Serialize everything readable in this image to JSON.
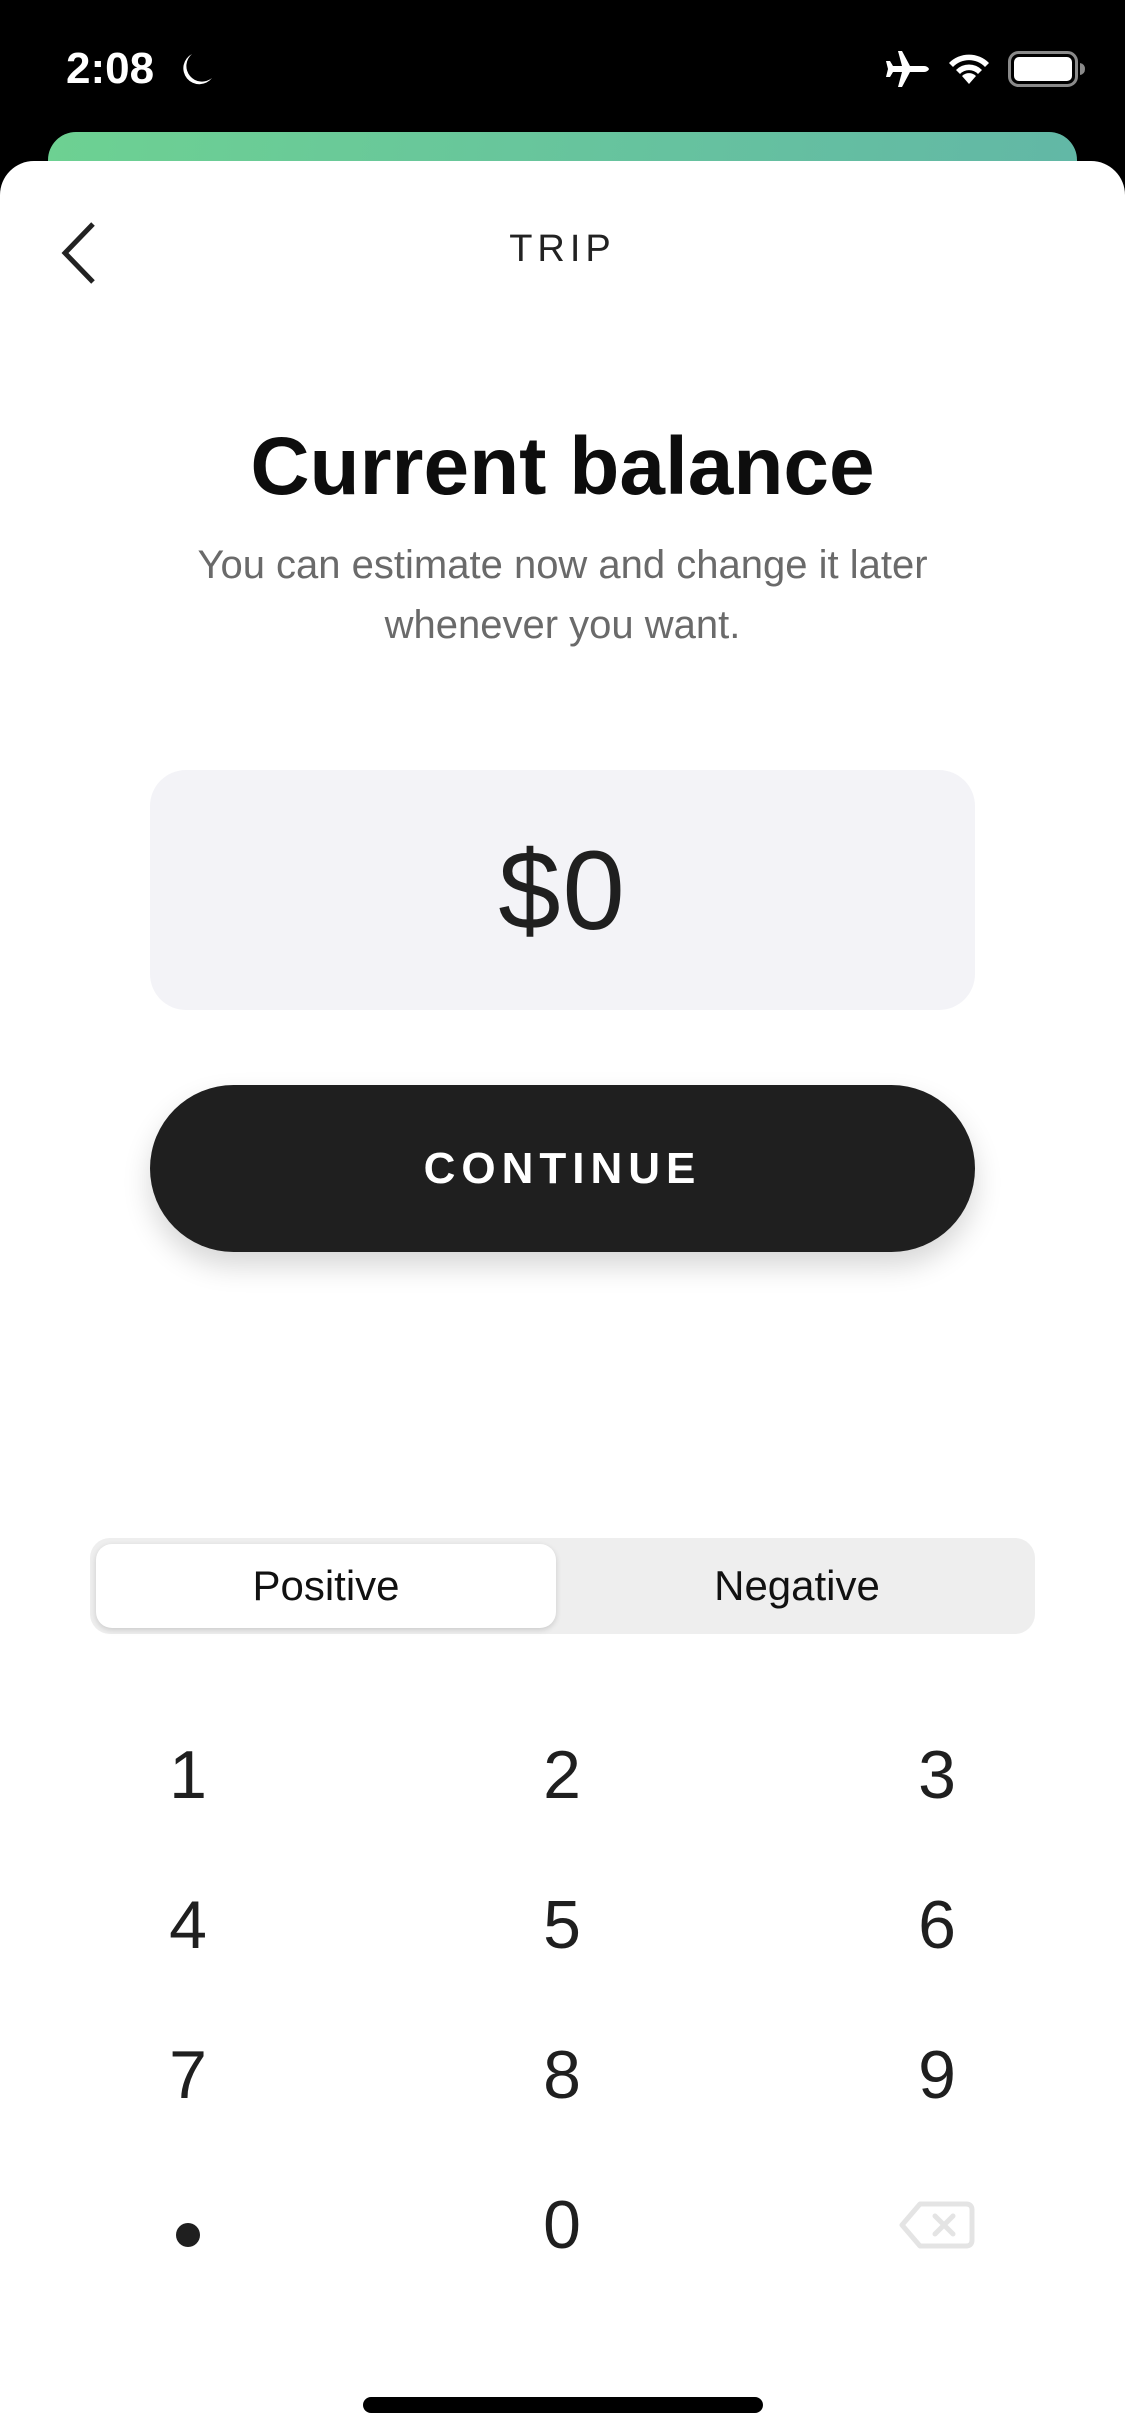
{
  "status_bar": {
    "time": "2:08",
    "icons": [
      "moon-icon",
      "airplane-mode-icon",
      "wifi-icon",
      "battery-icon"
    ]
  },
  "colors": {
    "accent_gradient_start": "#6dd192",
    "accent_gradient_end": "#62b7a6",
    "primary_button": "#1f1f1f",
    "field_background": "#f3f3f7",
    "subtitle_text": "#6a6a6a"
  },
  "nav": {
    "back_icon": "chevron-left-icon",
    "title": "TRIP"
  },
  "main": {
    "title": "Current balance",
    "subtitle": "You can estimate now and change it later whenever you want.",
    "amount": "$0",
    "continue_label": "CONTINUE"
  },
  "sign_toggle": {
    "options": [
      {
        "label": "Positive",
        "selected": true
      },
      {
        "label": "Negative",
        "selected": false
      }
    ]
  },
  "keypad": {
    "keys": [
      "1",
      "2",
      "3",
      "4",
      "5",
      "6",
      "7",
      "8",
      "9",
      ".",
      "0",
      "backspace"
    ]
  }
}
